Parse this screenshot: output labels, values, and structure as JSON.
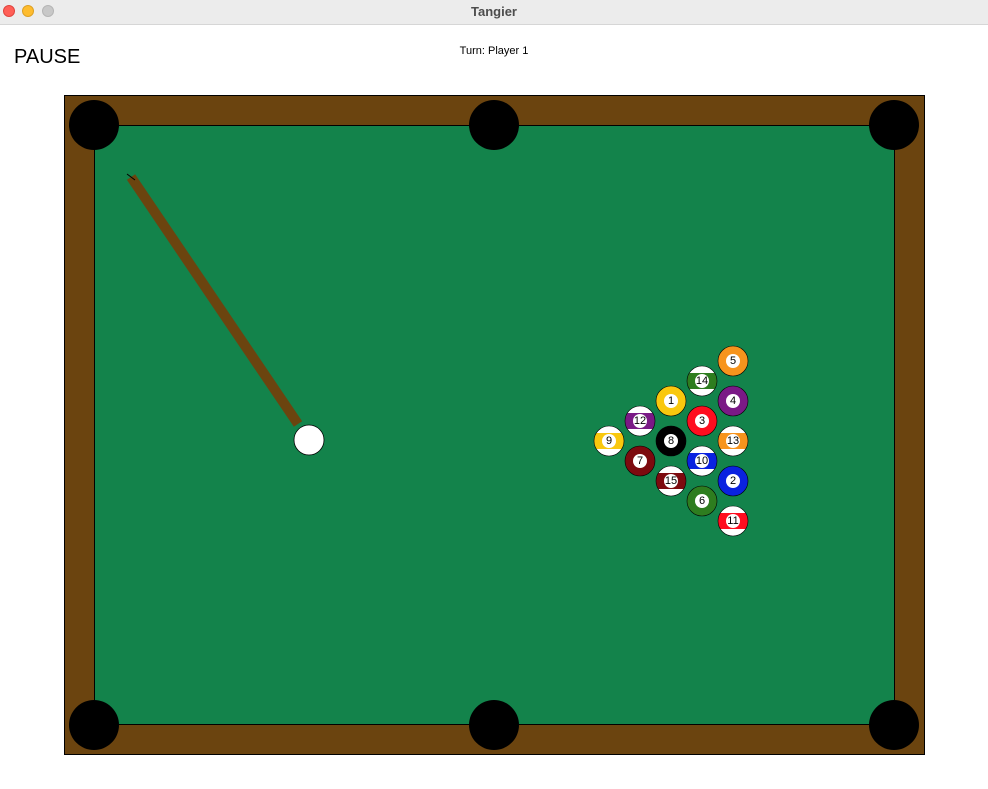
{
  "window": {
    "title": "Tangier"
  },
  "hud": {
    "pause_label": "PAUSE",
    "turn_text": "Turn: Player 1"
  },
  "colors": {
    "rail": "#6b440f",
    "felt": "#13834b",
    "pocket": "#000000",
    "cue_stick": "#6b440f",
    "cue_ball": "#ffffff"
  },
  "balls": [
    {
      "number": "5",
      "color": "#f7941d",
      "striped": false
    },
    {
      "number": "14",
      "color": "#2e7d1f",
      "striped": true
    },
    {
      "number": "1",
      "color": "#f9c80e",
      "striped": false
    },
    {
      "number": "4",
      "color": "#7a1a86",
      "striped": false
    },
    {
      "number": "12",
      "color": "#7a1a86",
      "striped": true
    },
    {
      "number": "3",
      "color": "#ff0d1f",
      "striped": false
    },
    {
      "number": "9",
      "color": "#f9c80e",
      "striped": true
    },
    {
      "number": "8",
      "color": "#000000",
      "striped": false
    },
    {
      "number": "13",
      "color": "#f7941d",
      "striped": true
    },
    {
      "number": "7",
      "color": "#7d0a0f",
      "striped": false
    },
    {
      "number": "10",
      "color": "#0a22e0",
      "striped": true
    },
    {
      "number": "15",
      "color": "#7d0a0f",
      "striped": true
    },
    {
      "number": "2",
      "color": "#0a22e0",
      "striped": false
    },
    {
      "number": "6",
      "color": "#2e7d1f",
      "striped": false
    },
    {
      "number": "11",
      "color": "#ff0d1f",
      "striped": true
    }
  ]
}
